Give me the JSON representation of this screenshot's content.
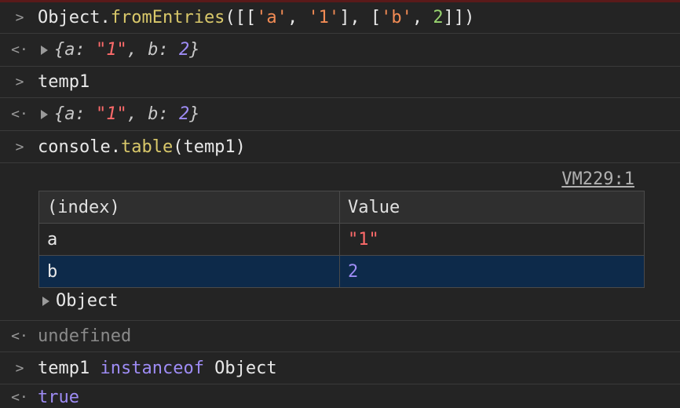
{
  "entries": [
    {
      "type": "input",
      "gutter": ">",
      "tokens": [
        {
          "t": "Object",
          "c": "c-white"
        },
        {
          "t": ".",
          "c": "c-white"
        },
        {
          "t": "fromEntries",
          "c": "c-fn"
        },
        {
          "t": "([[",
          "c": "c-white"
        },
        {
          "t": "'a'",
          "c": "c-str"
        },
        {
          "t": ", ",
          "c": "c-white"
        },
        {
          "t": "'1'",
          "c": "c-str"
        },
        {
          "t": "], [",
          "c": "c-white"
        },
        {
          "t": "'b'",
          "c": "c-str"
        },
        {
          "t": ", ",
          "c": "c-white"
        },
        {
          "t": "2",
          "c": "c-green"
        },
        {
          "t": "]])",
          "c": "c-white"
        }
      ]
    },
    {
      "type": "output",
      "gutter": "<·",
      "tokens": [
        {
          "t": "{a: ",
          "c": "c-key italic"
        },
        {
          "t": "\"1\"",
          "c": "c-str-red italic"
        },
        {
          "t": ", b: ",
          "c": "c-key italic"
        },
        {
          "t": "2",
          "c": "c-num italic"
        },
        {
          "t": "}",
          "c": "c-key italic"
        }
      ]
    },
    {
      "type": "input",
      "gutter": ">",
      "tokens": [
        {
          "t": "temp1",
          "c": "c-white"
        }
      ]
    },
    {
      "type": "output",
      "gutter": "<·",
      "tokens": [
        {
          "t": "{a: ",
          "c": "c-key italic"
        },
        {
          "t": "\"1\"",
          "c": "c-str-red italic"
        },
        {
          "t": ", b: ",
          "c": "c-key italic"
        },
        {
          "t": "2",
          "c": "c-num italic"
        },
        {
          "t": "}",
          "c": "c-key italic"
        }
      ]
    },
    {
      "type": "input",
      "gutter": ">",
      "tokens": [
        {
          "t": "console",
          "c": "c-white"
        },
        {
          "t": ".",
          "c": "c-white"
        },
        {
          "t": "table",
          "c": "c-fn"
        },
        {
          "t": "(temp1)",
          "c": "c-white"
        }
      ]
    }
  ],
  "table": {
    "source_link": "VM229:1",
    "headers": [
      "(index)",
      "Value"
    ],
    "rows": [
      {
        "index": "a",
        "value": "\"1\""
      },
      {
        "index": "b",
        "value": "2"
      }
    ],
    "footer_label": "Object"
  },
  "after": [
    {
      "type": "output",
      "gutter": "<·",
      "tokens": [
        {
          "t": "undefined",
          "c": "c-muted"
        }
      ]
    },
    {
      "type": "input",
      "gutter": ">",
      "tokens": [
        {
          "t": "temp1 ",
          "c": "c-white"
        },
        {
          "t": "instanceof",
          "c": "c-keyword"
        },
        {
          "t": " Object",
          "c": "c-white"
        }
      ]
    },
    {
      "type": "output",
      "gutter": "<·",
      "tokens": [
        {
          "t": "true",
          "c": "c-bool"
        }
      ]
    }
  ]
}
